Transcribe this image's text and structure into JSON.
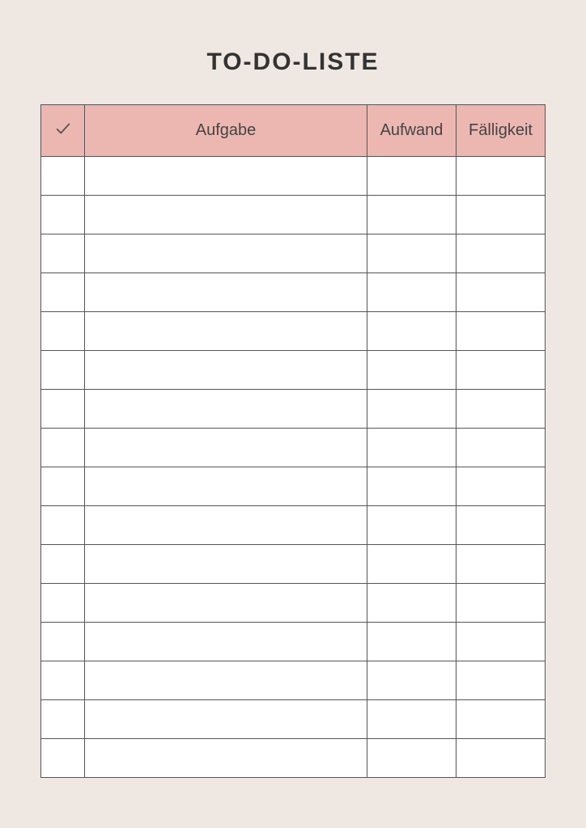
{
  "title": "TO-DO-LISTE",
  "columns": {
    "check_icon": "check-icon",
    "task": "Aufgabe",
    "effort": "Aufwand",
    "due": "Fälligkeit"
  },
  "rows": [
    {
      "done": "",
      "task": "",
      "effort": "",
      "due": ""
    },
    {
      "done": "",
      "task": "",
      "effort": "",
      "due": ""
    },
    {
      "done": "",
      "task": "",
      "effort": "",
      "due": ""
    },
    {
      "done": "",
      "task": "",
      "effort": "",
      "due": ""
    },
    {
      "done": "",
      "task": "",
      "effort": "",
      "due": ""
    },
    {
      "done": "",
      "task": "",
      "effort": "",
      "due": ""
    },
    {
      "done": "",
      "task": "",
      "effort": "",
      "due": ""
    },
    {
      "done": "",
      "task": "",
      "effort": "",
      "due": ""
    },
    {
      "done": "",
      "task": "",
      "effort": "",
      "due": ""
    },
    {
      "done": "",
      "task": "",
      "effort": "",
      "due": ""
    },
    {
      "done": "",
      "task": "",
      "effort": "",
      "due": ""
    },
    {
      "done": "",
      "task": "",
      "effort": "",
      "due": ""
    },
    {
      "done": "",
      "task": "",
      "effort": "",
      "due": ""
    },
    {
      "done": "",
      "task": "",
      "effort": "",
      "due": ""
    },
    {
      "done": "",
      "task": "",
      "effort": "",
      "due": ""
    },
    {
      "done": "",
      "task": "",
      "effort": "",
      "due": ""
    }
  ],
  "colors": {
    "page_bg": "#eee7e2",
    "header_bg": "#edb7b1",
    "cell_bg": "#ffffff",
    "border": "#555555",
    "text": "#333333"
  }
}
